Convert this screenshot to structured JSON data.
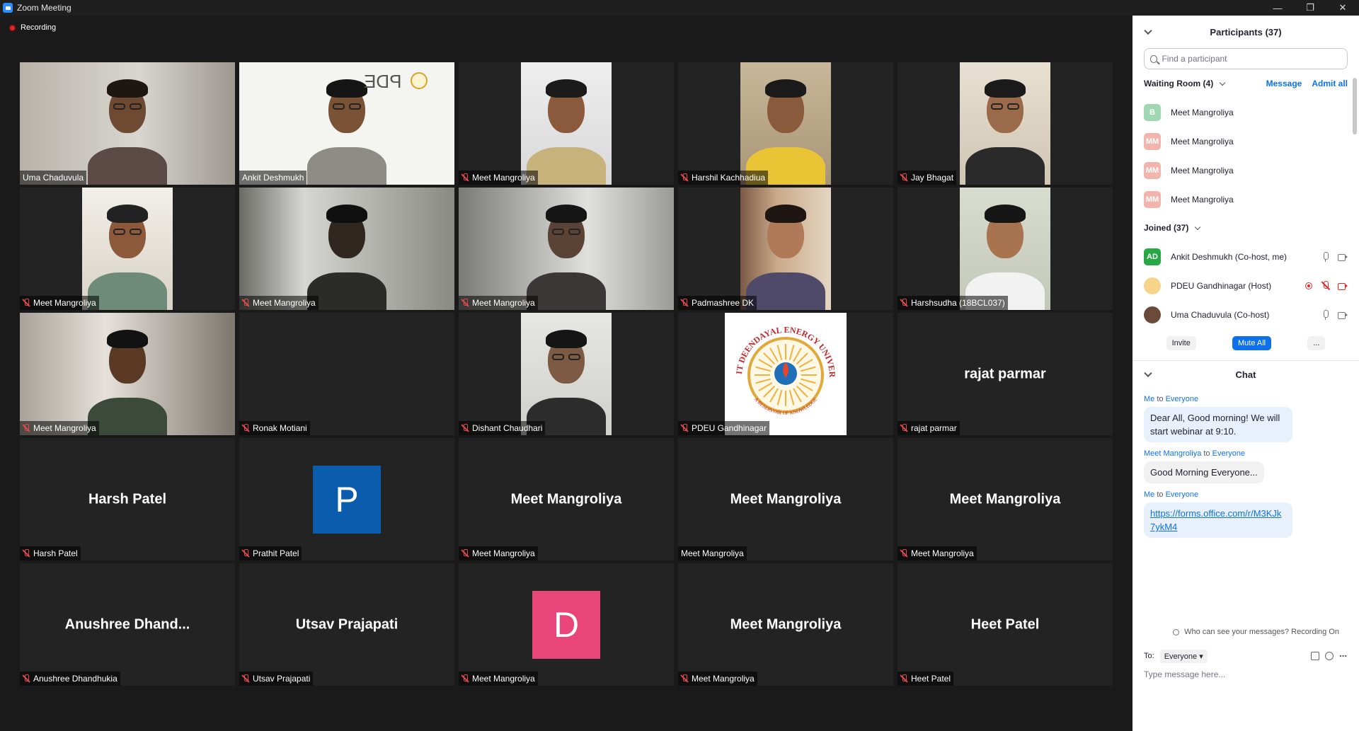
{
  "window": {
    "title": "Zoom Meeting"
  },
  "meeting": {
    "recording_label": "Recording",
    "tiles": [
      {
        "name": "Uma Chaduvula",
        "muted": false,
        "type": "video"
      },
      {
        "name": "Ankit Deshmukh",
        "muted": false,
        "type": "video",
        "active": true
      },
      {
        "name": "Meet Mangroliya",
        "muted": true,
        "type": "video"
      },
      {
        "name": "Harshil Kachhadiua",
        "muted": true,
        "type": "video"
      },
      {
        "name": "Jay Bhagat",
        "muted": true,
        "type": "video"
      },
      {
        "name": "Meet Mangroliya",
        "muted": true,
        "type": "video"
      },
      {
        "name": "Meet Mangroliya",
        "muted": true,
        "type": "video"
      },
      {
        "name": "Meet Mangroliya",
        "muted": true,
        "type": "video"
      },
      {
        "name": "Padmashree DK",
        "muted": true,
        "type": "video"
      },
      {
        "name": "Harshsudha (18BCL037)",
        "muted": true,
        "type": "video"
      },
      {
        "name": "Meet Mangroliya",
        "muted": true,
        "type": "video"
      },
      {
        "name": "Ronak Motiani",
        "muted": true,
        "type": "blank"
      },
      {
        "name": "Dishant Chaudhari",
        "muted": true,
        "type": "video"
      },
      {
        "name": "PDEU Gandhinagar",
        "muted": true,
        "type": "logo"
      },
      {
        "name": "rajat parmar",
        "muted": true,
        "type": "name",
        "display": "rajat parmar"
      },
      {
        "name": "Harsh Patel",
        "muted": true,
        "type": "name",
        "display": "Harsh Patel"
      },
      {
        "name": "Prathit Patel",
        "muted": true,
        "type": "avatar",
        "letter": "P",
        "color": "#0b5cad"
      },
      {
        "name": "Meet Mangroliya",
        "muted": true,
        "type": "name",
        "display": "Meet Mangroliya"
      },
      {
        "name": "Meet Mangroliya",
        "muted": false,
        "type": "name",
        "display": "Meet Mangroliya"
      },
      {
        "name": "Meet Mangroliya",
        "muted": true,
        "type": "name",
        "display": "Meet Mangroliya"
      },
      {
        "name": "Anushree Dhandhukia",
        "muted": true,
        "type": "name",
        "display": "Anushree  Dhand..."
      },
      {
        "name": "Utsav Prajapati",
        "muted": true,
        "type": "name",
        "display": "Utsav Prajapati"
      },
      {
        "name": "Meet Mangroliya",
        "muted": true,
        "type": "avatar",
        "letter": "D",
        "color": "#e8457a"
      },
      {
        "name": "Meet Mangroliya",
        "muted": true,
        "type": "name",
        "display": "Meet Mangroliya"
      },
      {
        "name": "Heet Patel",
        "muted": true,
        "type": "name",
        "display": "Heet Patel"
      }
    ],
    "logo_text": {
      "ring": "PANDIT DEENDAYAL ENERGY UNIVERSITY",
      "motto": "A RESERVOIR OF KNOWLEDGE",
      "banner": "PDE"
    }
  },
  "participants": {
    "title": "Participants (37)",
    "search_placeholder": "Find a participant",
    "waiting_room": {
      "label": "Waiting Room (4)",
      "message_label": "Message",
      "admit_all_label": "Admit all",
      "items": [
        {
          "initials": "B",
          "name": "Meet Mangroliya",
          "color": "#9fd8b0"
        },
        {
          "initials": "MM",
          "name": "Meet Mangroliya",
          "color": "#f2b5ad"
        },
        {
          "initials": "MM",
          "name": "Meet Mangroliya",
          "color": "#f2b5ad"
        },
        {
          "initials": "MM",
          "name": "Meet Mangroliya",
          "color": "#f2b5ad"
        }
      ]
    },
    "joined": {
      "label": "Joined (37)",
      "items": [
        {
          "initials": "AD",
          "name": "Ankit Deshmukh (Co-host, me)",
          "color": "#28a745",
          "muted": false,
          "video_off": false,
          "recording": false
        },
        {
          "initials": "",
          "name": "PDEU Gandhinagar (Host)",
          "color": "#f6d58a",
          "muted": true,
          "video_off": true,
          "recording": true
        },
        {
          "initials": "",
          "name": "Uma Chaduvula (Co-host)",
          "color": "#6b4a3a",
          "muted": false,
          "video_off": false,
          "recording": false
        }
      ]
    },
    "invite_label": "Invite",
    "mute_all_label": "Mute All",
    "more_label": "..."
  },
  "chat": {
    "title": "Chat",
    "messages": [
      {
        "from": "Me",
        "to_word": "to",
        "to": "Everyone",
        "text": "Dear All, Good morning! We will start webinar at 9:10.",
        "link": false,
        "own": true
      },
      {
        "from": "Meet Mangroliya",
        "to_word": "to",
        "to": "Everyone",
        "text": "Good Morning Everyone...",
        "link": false,
        "own": false
      },
      {
        "from": "Me",
        "to_word": "to",
        "to": "Everyone",
        "text": "https://forms.office.com/r/M3KJk7ykM4",
        "link": true,
        "own": true
      }
    ],
    "who_can_see": "Who can see your messages? Recording On",
    "to_label": "To:",
    "recipient": "Everyone",
    "input_placeholder": "Type message here..."
  }
}
